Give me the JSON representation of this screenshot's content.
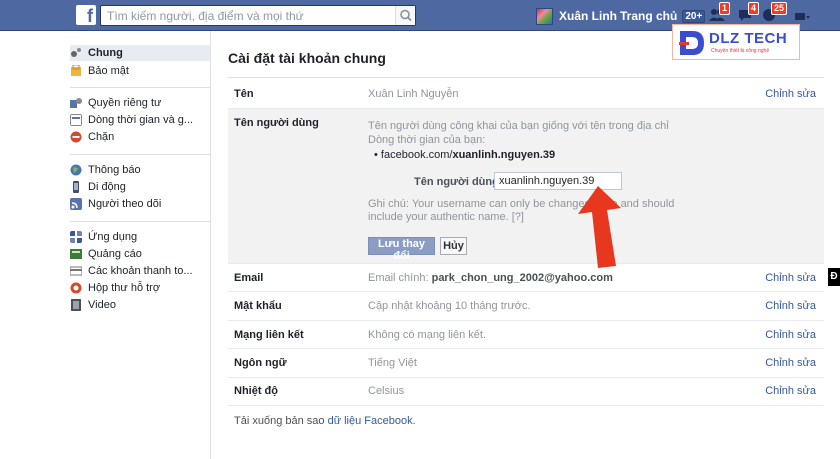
{
  "topbar": {
    "logo": "f",
    "search_placeholder": "Tìm kiếm người, địa điểm và mọi thứ",
    "user_name": "Xuân Linh",
    "home_label": "Trang chủ",
    "home_badge": "20+",
    "friend_requests_badge": "1",
    "messages_badge": "4",
    "notifications_badge": "25"
  },
  "sidebar": {
    "items": [
      {
        "label": "Chung",
        "icon": "gear-icon",
        "active": true
      },
      {
        "label": "Bảo mật",
        "icon": "lock-icon"
      },
      {
        "label": "Quyền riêng tư",
        "icon": "privacy-icon"
      },
      {
        "label": "Dòng thời gian và g...",
        "icon": "timeline-icon"
      },
      {
        "label": "Chặn",
        "icon": "block-icon"
      },
      {
        "label": "Thông báo",
        "icon": "globe-icon"
      },
      {
        "label": "Di động",
        "icon": "mobile-icon"
      },
      {
        "label": "Người theo dõi",
        "icon": "rss-icon"
      },
      {
        "label": "Ứng dụng",
        "icon": "apps-icon"
      },
      {
        "label": "Quảng cáo",
        "icon": "ads-icon"
      },
      {
        "label": "Các khoản thanh to...",
        "icon": "payment-icon"
      },
      {
        "label": "Hộp thư hỗ trợ",
        "icon": "support-icon"
      },
      {
        "label": "Video",
        "icon": "video-icon"
      }
    ]
  },
  "main": {
    "title": "Cài đặt tài khoản chung",
    "edit_label": "Chỉnh sửa",
    "name_row": {
      "label": "Tên",
      "value": "Xuân Linh Nguyễn"
    },
    "username_section": {
      "label": "Tên người dùng",
      "description": "Tên người dùng công khai của bạn giống với tên trong địa chỉ Dòng thời gian của bạn:",
      "url_prefix": "facebook.com/",
      "url_username": "xuanlinh.nguyen.39",
      "field_label": "Tên người dùng",
      "field_value": "xuanlinh.nguyen.39",
      "note": "Ghi chú: Your username can only be changed once and should include your authentic name.",
      "note_help": "[?]",
      "save_label": "Lưu thay đổi",
      "cancel_label": "Hủy"
    },
    "email_row": {
      "label": "Email",
      "value_prefix": "Email chính:",
      "value": "park_chon_ung_2002@yahoo.com"
    },
    "password_row": {
      "label": "Mật khẩu",
      "value": "Cập nhật khoảng 10 tháng trước."
    },
    "network_row": {
      "label": "Mạng liên kết",
      "value": "Không có mạng liên kết."
    },
    "language_row": {
      "label": "Ngôn ngữ",
      "value": "Tiếng Việt"
    },
    "temperature_row": {
      "label": "Nhiệt độ",
      "value": "Celsius"
    },
    "footer_prefix": "Tải xuống bản sao",
    "footer_link": "dữ liệu Facebook",
    "footer_suffix": "."
  },
  "watermark": {
    "brand": "DLZ TECH",
    "tagline": "Chuyên thiết bị công nghệ"
  },
  "side_tab": "Đ",
  "colors": {
    "header_blue": "#4e69a2",
    "link_blue": "#365899",
    "badge_red": "#f03d25",
    "arrow_red": "#e8371f"
  }
}
